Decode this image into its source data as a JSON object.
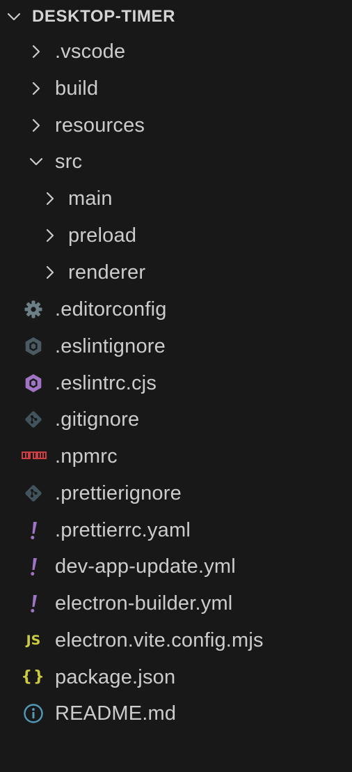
{
  "explorer": {
    "root": {
      "label": "DESKTOP-TIMER",
      "chevron": "chevron-down-icon"
    },
    "folders": [
      {
        "label": ".vscode",
        "state": "collapsed"
      },
      {
        "label": "build",
        "state": "collapsed"
      },
      {
        "label": "resources",
        "state": "collapsed"
      },
      {
        "label": "src",
        "state": "expanded"
      }
    ],
    "src_children": [
      {
        "label": "main",
        "state": "collapsed"
      },
      {
        "label": "preload",
        "state": "collapsed"
      },
      {
        "label": "renderer",
        "state": "collapsed"
      }
    ],
    "files": [
      {
        "label": ".editorconfig",
        "icon": "gear-icon",
        "icon_color": "#6d8086"
      },
      {
        "label": ".eslintignore",
        "icon": "eslint-icon",
        "icon_color": "#4b5a60"
      },
      {
        "label": ".eslintrc.cjs",
        "icon": "eslint-icon",
        "icon_color": "#a074c4"
      },
      {
        "label": ".gitignore",
        "icon": "git-icon",
        "icon_color": "#41535b"
      },
      {
        "label": ".npmrc",
        "icon": "npm-icon",
        "icon_color": "#cc3e44"
      },
      {
        "label": ".prettierignore",
        "icon": "git-icon",
        "icon_color": "#41535b"
      },
      {
        "label": ".prettierrc.yaml",
        "icon": "yaml-icon",
        "icon_color": "#a074c4"
      },
      {
        "label": "dev-app-update.yml",
        "icon": "yaml-icon",
        "icon_color": "#a074c4"
      },
      {
        "label": "electron-builder.yml",
        "icon": "yaml-icon",
        "icon_color": "#a074c4"
      },
      {
        "label": "electron.vite.config.mjs",
        "icon": "javascript-icon",
        "icon_color": "#cbcb41",
        "icon_text": "JS"
      },
      {
        "label": "package.json",
        "icon": "json-icon",
        "icon_color": "#cbcb41",
        "icon_text": "{}"
      },
      {
        "label": "README.md",
        "icon": "info-icon",
        "icon_color": "#519aba"
      }
    ]
  }
}
